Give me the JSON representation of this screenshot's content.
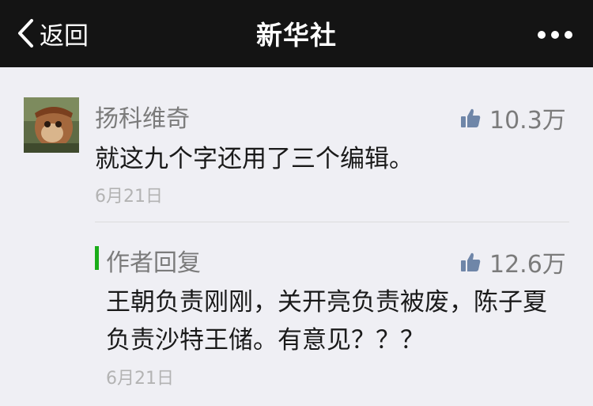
{
  "nav": {
    "back_label": "返回",
    "title": "新华社",
    "more_icon": "more-dots-icon"
  },
  "comment": {
    "author": "扬科维奇",
    "likes": "10.3万",
    "text": "就这九个字还用了三个编辑。",
    "date": "6月21日"
  },
  "reply": {
    "label": "作者回复",
    "likes": "12.6万",
    "text": "王朝负责刚刚，关开亮负责被废，陈子夏负责沙特王储。有意见？？？",
    "date": "6月21日"
  },
  "colors": {
    "nav_bg": "#141414",
    "page_bg": "#efeff4",
    "reply_accent": "#1aad19",
    "like_icon": "#6f86a8"
  }
}
